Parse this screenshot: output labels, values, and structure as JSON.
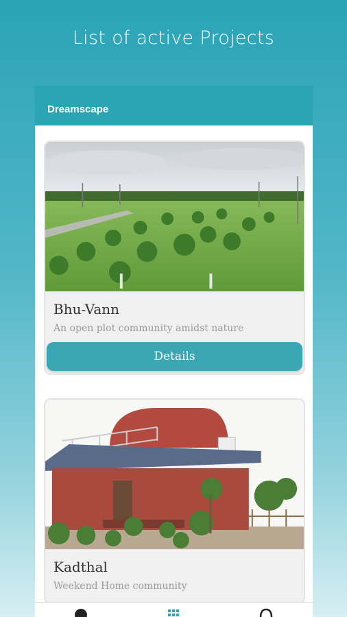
{
  "header": {
    "title": "List of active Projects"
  },
  "panel": {
    "title": "Dreamscape"
  },
  "projects": [
    {
      "name": "Bhu-Vann",
      "description": "An open plot community amidst nature",
      "button": "Details"
    },
    {
      "name": "Kadthal",
      "description": "Weekend Home community"
    }
  ],
  "bottom_nav": {
    "items": [
      {
        "icon": "info-icon"
      },
      {
        "icon": "grid-icon",
        "active": true
      },
      {
        "icon": "headset-icon"
      }
    ]
  },
  "colors": {
    "accent": "#2ba4b4",
    "button": "#3aa7b5"
  }
}
